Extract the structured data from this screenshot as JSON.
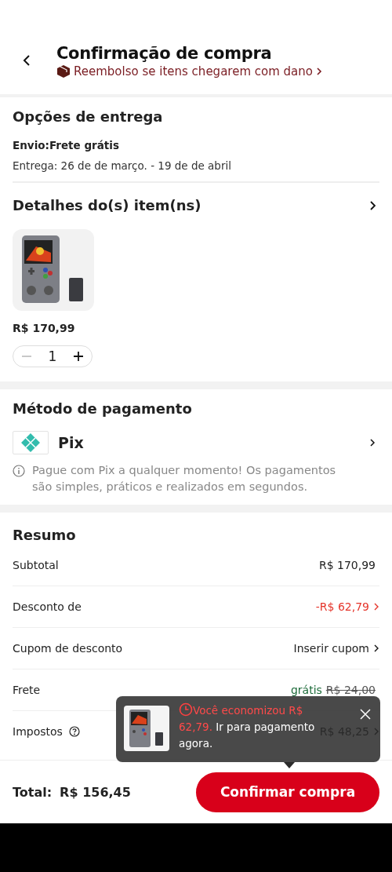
{
  "header": {
    "title": "Confirmação de compra",
    "notice": "Reembolso se itens chegarem com dano"
  },
  "delivery": {
    "title": "Opções de entrega",
    "shipping": "Envio:Frete grátis",
    "dates": "Entrega: 26 de de março. - 19 de de abril"
  },
  "items": {
    "title": "Detalhes do(s) item(ns)",
    "products": [
      {
        "price": "R$ 170,99",
        "quantity": "1"
      }
    ]
  },
  "payment": {
    "title": "Método de pagamento",
    "method": "Pix",
    "info": "Pague com Pix a qualquer momento! Os pagamentos são simples, práticos e realizados em segundos."
  },
  "summary": {
    "title": "Resumo",
    "rows": [
      {
        "label": "Subtotal",
        "value": "R$ 170,99",
        "kind": "plain",
        "chevron": false
      },
      {
        "label": "Desconto de",
        "value": "-R$ 62,79",
        "kind": "discount",
        "chevron": true
      },
      {
        "label": "Cupom de desconto",
        "value": "Inserir cupom",
        "kind": "plain",
        "chevron": true
      },
      {
        "label": "Frete",
        "value": "grátis",
        "old_value": "R$ 24,00",
        "kind": "free",
        "chevron": false
      },
      {
        "label": "Impostos",
        "value": "R$ 48,25",
        "kind": "help",
        "chevron": true
      }
    ]
  },
  "popup": {
    "highlight": "Você economizou R$ 62,79.",
    "text": "Ir para pagamento agora."
  },
  "footer": {
    "total_label": "Total:",
    "total": "R$ 156,45",
    "button": "Confirmar compra"
  }
}
